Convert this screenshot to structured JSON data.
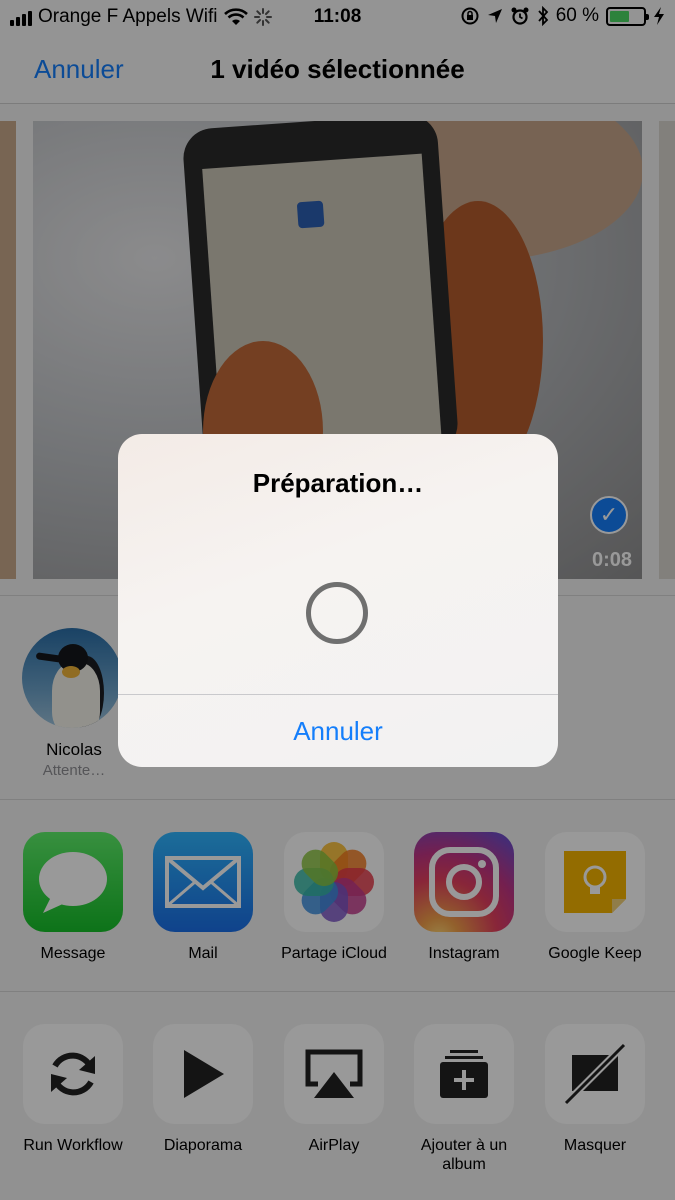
{
  "status_bar": {
    "carrier": "Orange F Appels Wifi",
    "time": "11:08",
    "battery": "60 %"
  },
  "nav": {
    "cancel": "Annuler",
    "title": "1 vidéo sélectionnée"
  },
  "video": {
    "duration": "0:08"
  },
  "airdrop": {
    "person_name": "Nicolas",
    "person_status": "Attente…"
  },
  "share_apps": [
    {
      "label": "Message",
      "icon": "messages-icon"
    },
    {
      "label": "Mail",
      "icon": "mail-icon"
    },
    {
      "label": "Partage iCloud",
      "icon": "photos-icon"
    },
    {
      "label": "Instagram",
      "icon": "instagram-icon"
    },
    {
      "label": "Google Keep",
      "icon": "google-keep-icon"
    }
  ],
  "actions": [
    {
      "label": "Run Workflow",
      "icon": "refresh-icon"
    },
    {
      "label": "Diaporama",
      "icon": "play-icon"
    },
    {
      "label": "AirPlay",
      "icon": "airplay-icon"
    },
    {
      "label": "Ajouter à un album",
      "icon": "add-to-album-icon"
    },
    {
      "label": "Masquer",
      "icon": "hide-icon"
    }
  ],
  "alert": {
    "title": "Préparation…",
    "cancel": "Annuler"
  },
  "colors": {
    "accent": "#147efb",
    "battery": "#4cd964"
  }
}
